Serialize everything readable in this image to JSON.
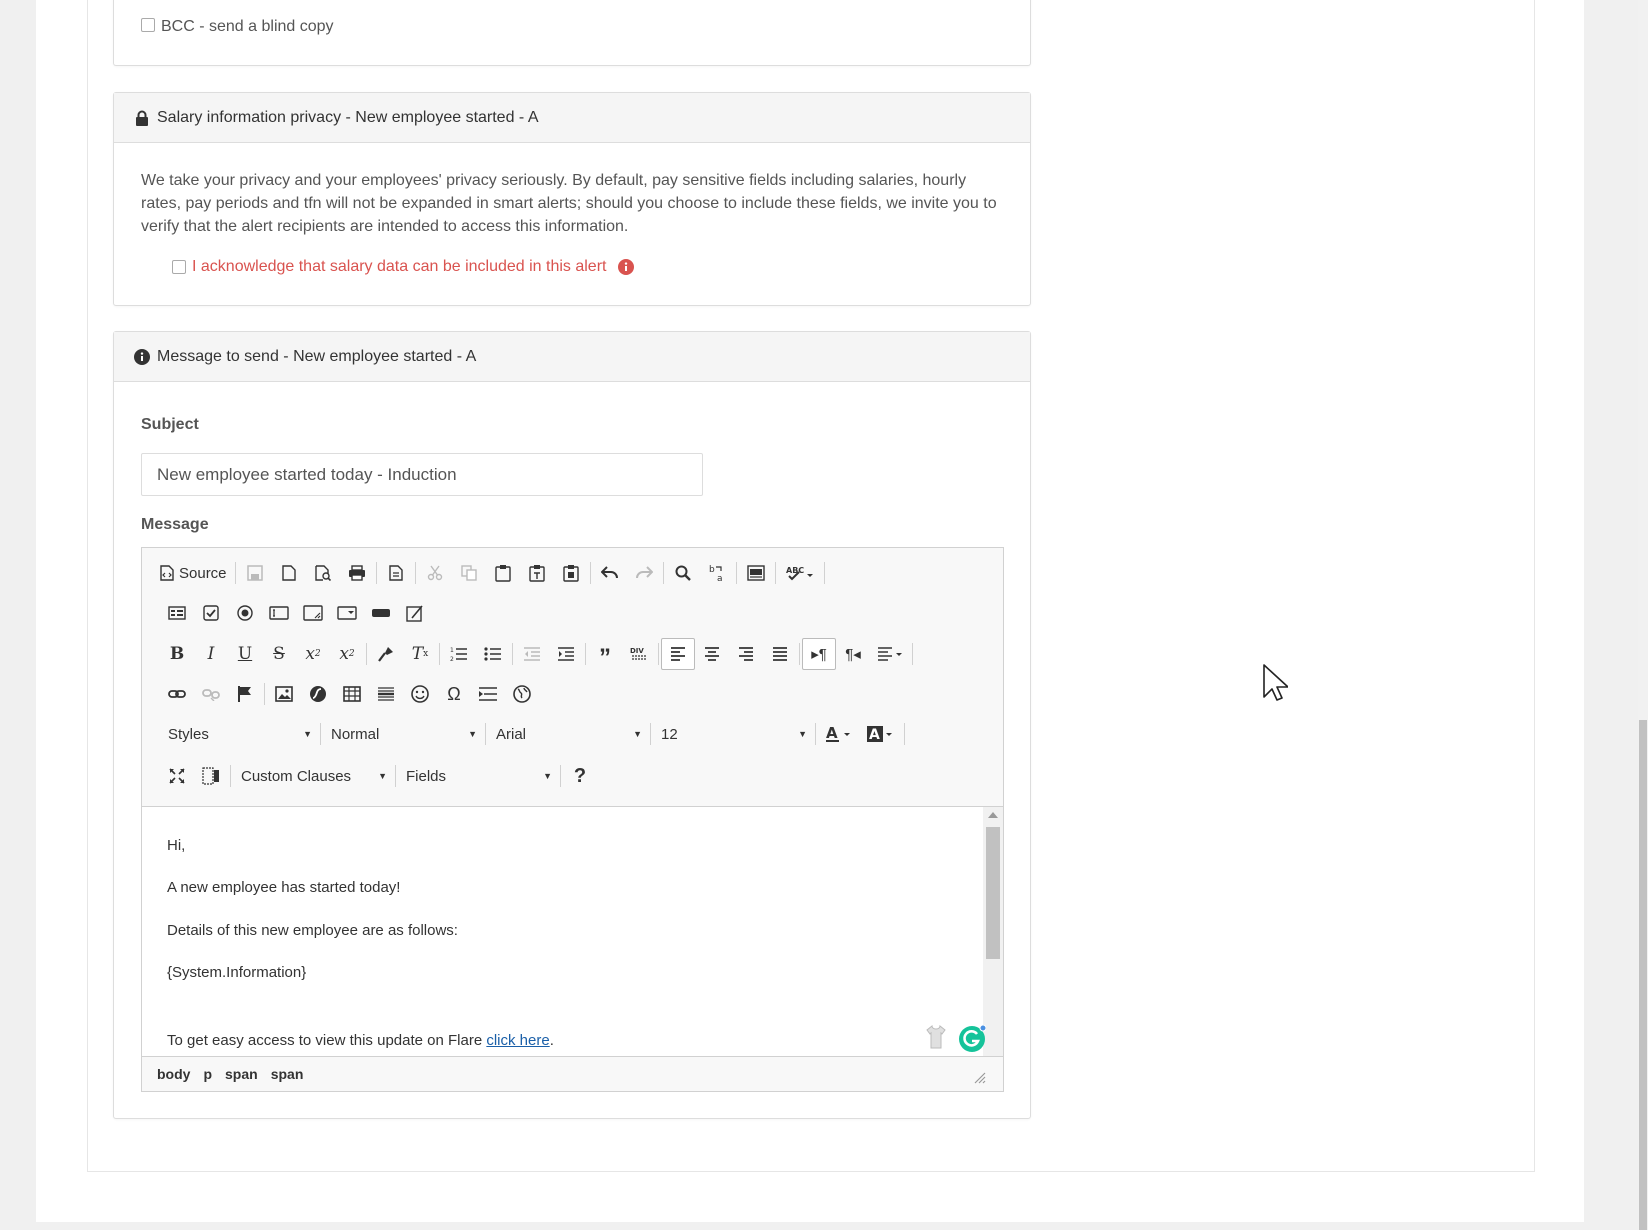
{
  "bcc": {
    "label": "BCC - send a blind copy"
  },
  "privacy": {
    "title": "Salary information privacy - New employee started - A",
    "body": "We take your privacy and your employees' privacy seriously. By default, pay sensitive fields including salaries, hourly rates, pay periods and tfn will not be expanded in smart alerts; should you choose to include these fields, we invite you to verify that the alert recipients are intended to access this information.",
    "ack_label": "I acknowledge that salary data can be included in this alert",
    "ack_color": "#d9534f"
  },
  "message_panel": {
    "title": "Message to send - New employee started - A",
    "subject_label": "Subject",
    "subject_value": "New employee started today - Induction",
    "message_label": "Message"
  },
  "editor": {
    "source_label": "Source",
    "styles_combo": "Styles",
    "format_combo": "Normal",
    "font_combo": "Arial",
    "size_combo": "12",
    "clauses_combo": "Custom Clauses",
    "fields_combo": "Fields",
    "help_label": "?",
    "content": {
      "line1": "Hi,",
      "line2": "A new employee has started today!",
      "line3": "Details of this new employee are as follows:",
      "line4": "{System.Information}",
      "line5_prefix": "To get easy access to view this update on Flare ",
      "line5_link": "click here",
      "line5_suffix": "."
    },
    "path": [
      "body",
      "p",
      "span",
      "span"
    ],
    "grammarly_color": "#15c39a"
  }
}
